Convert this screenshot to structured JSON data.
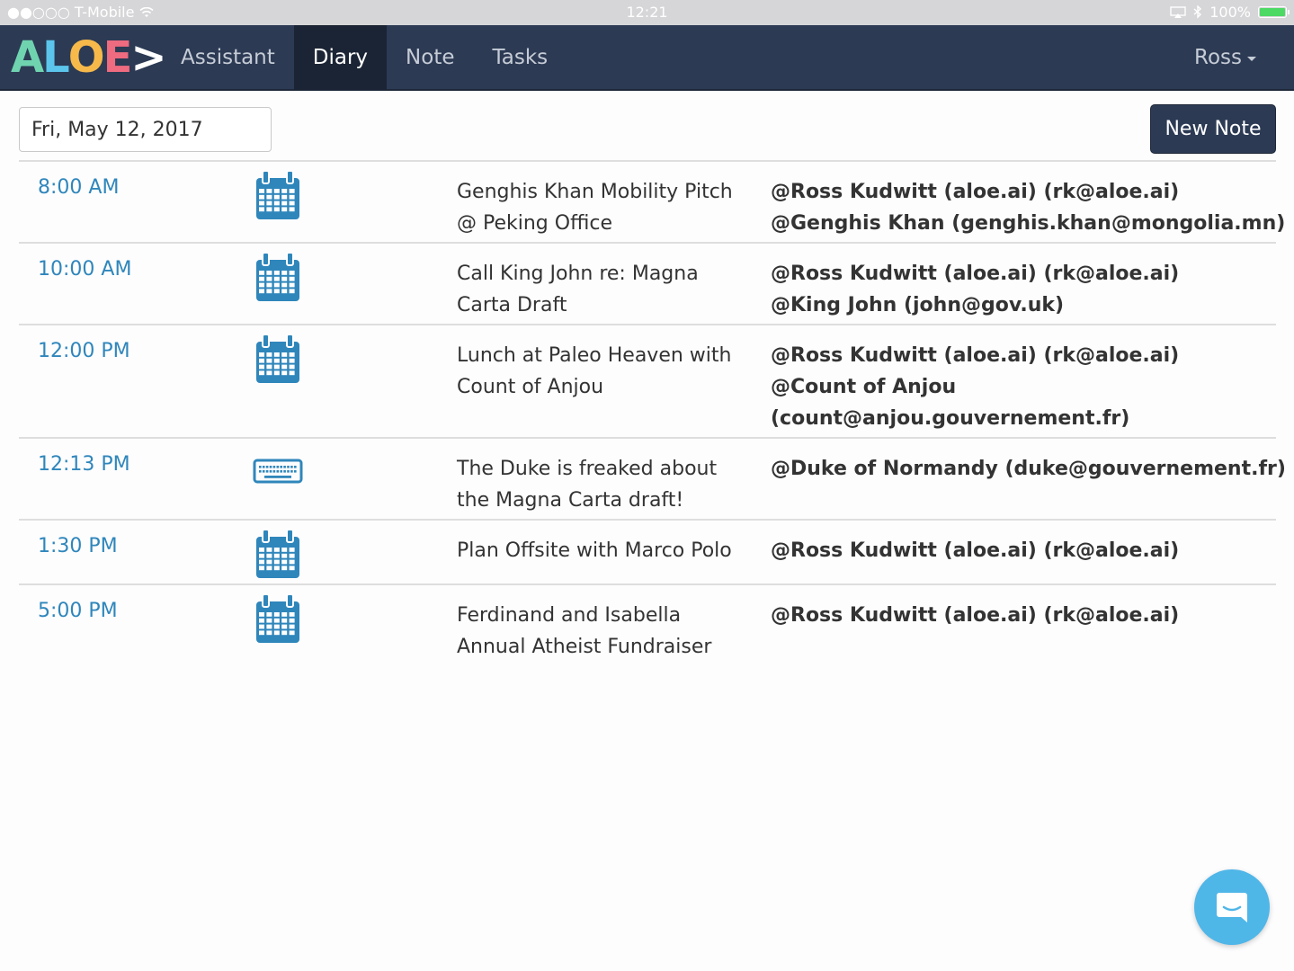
{
  "status_bar": {
    "carrier": "●●○○○ T-Mobile",
    "time": "12:21",
    "battery": "100%"
  },
  "nav": {
    "logo_letters": [
      "A",
      "L",
      "O",
      "E",
      ">"
    ],
    "logo_colors": [
      "#6fd3b0",
      "#5cc5ec",
      "#f6b94a",
      "#ef6b7f",
      "#ffffff"
    ],
    "items": [
      {
        "label": "Assistant"
      },
      {
        "label": "Diary"
      },
      {
        "label": "Note"
      },
      {
        "label": "Tasks"
      }
    ],
    "active": "Diary",
    "user": "Ross"
  },
  "toolbar": {
    "date_value": "Fri, May 12, 2017",
    "new_note_label": "New Note"
  },
  "entries": [
    {
      "time": "8:00 AM",
      "icon": "calendar-icon",
      "title": "Genghis Khan Mobility Pitch @ Peking Office",
      "people": [
        "@Ross Kudwitt (aloe.ai) (rk@aloe.ai)",
        "@Genghis Khan (genghis.khan@mongolia.mn)"
      ]
    },
    {
      "time": "10:00 AM",
      "icon": "calendar-icon",
      "title": "Call King John re: Magna Carta Draft",
      "people": [
        "@Ross Kudwitt (aloe.ai) (rk@aloe.ai)",
        "@King John (john@gov.uk)"
      ]
    },
    {
      "time": "12:00 PM",
      "icon": "calendar-icon",
      "title": "Lunch at Paleo Heaven with Count of Anjou",
      "people": [
        "@Ross Kudwitt (aloe.ai) (rk@aloe.ai)",
        "@Count of Anjou",
        "(count@anjou.gouvernement.fr)"
      ]
    },
    {
      "time": "12:13 PM",
      "icon": "keyboard-icon",
      "title": "The Duke is freaked about the Magna Carta draft!",
      "people": [
        "@Duke of Normandy (duke@gouvernement.fr)"
      ]
    },
    {
      "time": "1:30 PM",
      "icon": "calendar-icon",
      "title": "Plan Offsite with Marco Polo",
      "people": [
        "@Ross Kudwitt (aloe.ai) (rk@aloe.ai)"
      ]
    },
    {
      "time": "5:00 PM",
      "icon": "calendar-icon",
      "title": "Ferdinand and Isabella Annual Atheist Fundraiser",
      "people": [
        "@Ross Kudwitt (aloe.ai) (rk@aloe.ai)"
      ]
    }
  ],
  "colors": {
    "navbar": "#2c3a54",
    "accent": "#2f86bb",
    "chat": "#4fb6e8"
  }
}
